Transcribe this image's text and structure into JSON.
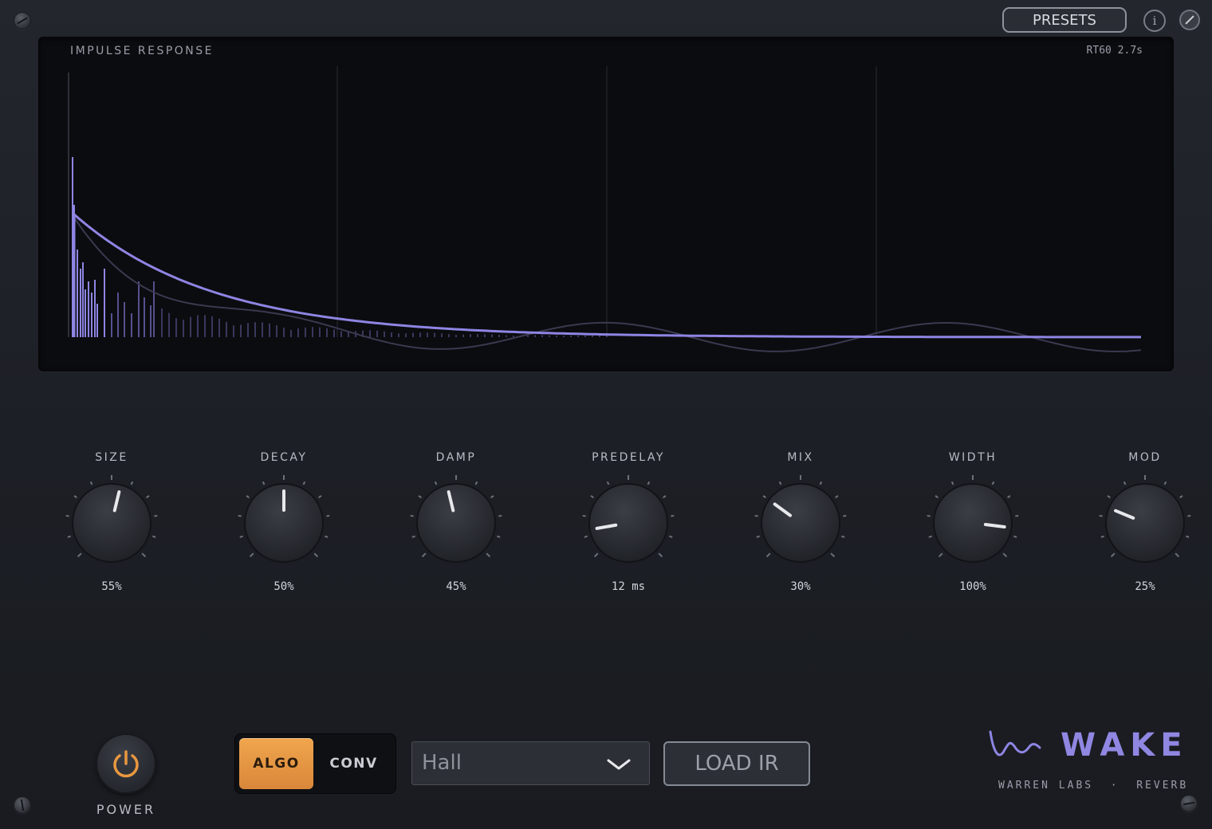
{
  "header": {
    "presets_label": "PRESETS",
    "info_label": "i"
  },
  "display": {
    "title": "IMPULSE RESPONSE",
    "rt60": "RT60 2.7s",
    "accent_color": "#8e85e3"
  },
  "knobs": [
    {
      "label": "SIZE",
      "value": "55%",
      "level": 0.55
    },
    {
      "label": "DECAY",
      "value": "50%",
      "level": 0.5
    },
    {
      "label": "DAMP",
      "value": "45%",
      "level": 0.45
    },
    {
      "label": "PREDELAY",
      "value": "12 ms",
      "level": 0.13
    },
    {
      "label": "MIX",
      "value": "30%",
      "level": 0.3
    },
    {
      "label": "WIDTH",
      "value": "100%",
      "level": 0.86
    },
    {
      "label": "MOD",
      "value": "25%",
      "level": 0.25
    }
  ],
  "footer": {
    "power_label": "POWER",
    "power_on": true,
    "mode_options": [
      "ALGO",
      "CONV"
    ],
    "mode_selected": "ALGO",
    "ir_select_value": "Hall",
    "load_ir_label": "LOAD IR",
    "brand_name": "WAKE",
    "brand_sub": "WARREN LABS  ·  REVERB",
    "active_color": "#e8983f"
  }
}
